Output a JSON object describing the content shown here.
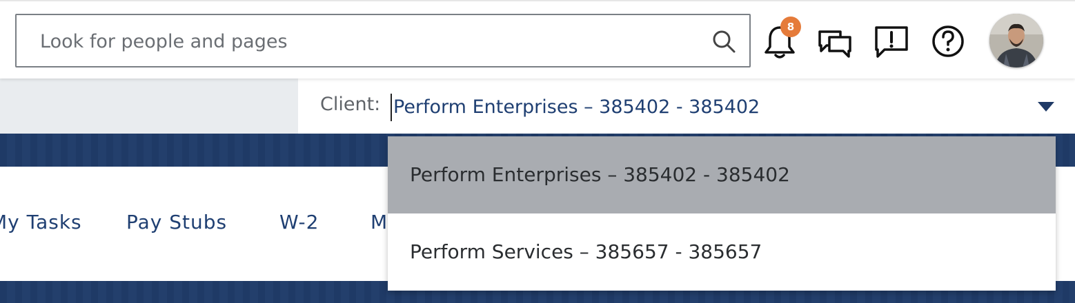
{
  "header": {
    "search_placeholder": "Look for people and pages",
    "notification_count": "8",
    "icons": [
      "search-icon",
      "bell-icon",
      "chat-icon",
      "feedback-icon",
      "help-icon",
      "avatar"
    ]
  },
  "client": {
    "label": "Client:",
    "selected": "Perform Enterprises – 385402 - 385402"
  },
  "nav": {
    "items": [
      "My Tasks",
      "Pay Stubs",
      "W-2",
      "M"
    ]
  },
  "dropdown": {
    "options": [
      "Perform Enterprises – 385402 - 385402",
      "Perform Services – 385657 - 385657"
    ]
  },
  "colors": {
    "navy": "#1f3a66",
    "link_blue": "#1f3f72",
    "badge_orange": "#e57b3a",
    "selected_option_bg": "#a9acb1"
  }
}
